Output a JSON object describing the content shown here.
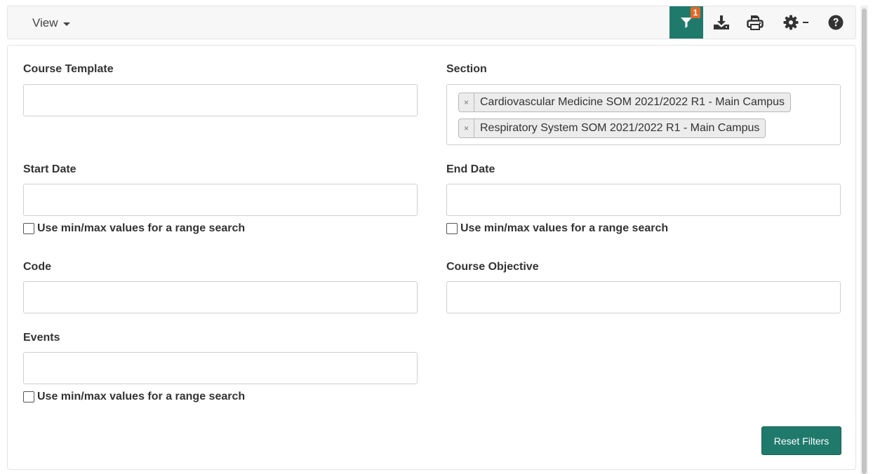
{
  "toolbar": {
    "view_label": "View",
    "filter_badge": "1",
    "filter_color": "#1f7a6c",
    "badge_color": "#e0692a",
    "icons": [
      "filter-icon",
      "download-icon",
      "print-icon",
      "gear-icon",
      "help-icon"
    ]
  },
  "filters": {
    "course_template": {
      "label": "Course Template",
      "value": ""
    },
    "section": {
      "label": "Section",
      "tags": [
        "Cardiovascular Medicine SOM 2021/2022 R1 - Main Campus",
        "Respiratory System SOM 2021/2022 R1 - Main Campus"
      ],
      "remove_symbol": "×"
    },
    "start_date": {
      "label": "Start Date",
      "value": "",
      "range_label": "Use min/max values for a range search"
    },
    "end_date": {
      "label": "End Date",
      "value": "",
      "range_label": "Use min/max values for a range search"
    },
    "code": {
      "label": "Code",
      "value": ""
    },
    "course_objective": {
      "label": "Course Objective",
      "value": ""
    },
    "events": {
      "label": "Events",
      "value": "",
      "range_label": "Use min/max values for a range search"
    }
  },
  "reset_label": "Reset Filters"
}
